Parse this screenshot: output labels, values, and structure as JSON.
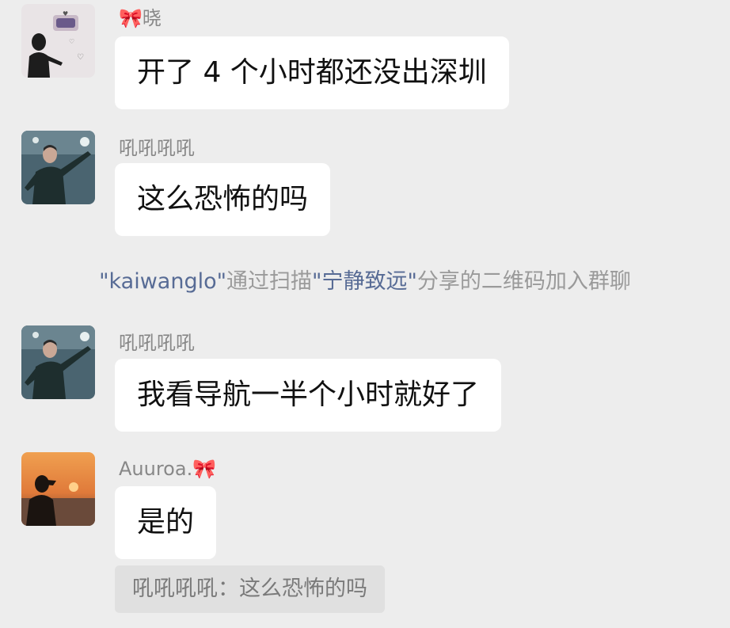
{
  "messages": [
    {
      "sender": "🎀晓",
      "text": "开了 4 个小时都还没出深圳",
      "avatar_icon": "girl-silhouette-cake-avatar"
    },
    {
      "sender": "吼吼吼吼",
      "text": "这么恐怖的吗",
      "avatar_icon": "man-pointing-avatar"
    },
    {
      "sender": "吼吼吼吼",
      "text": "我看导航一半个小时就好了",
      "avatar_icon": "man-pointing-avatar"
    },
    {
      "sender": "Auuroa.🎀",
      "text": "是的",
      "avatar_icon": "sunset-silhouette-avatar"
    }
  ],
  "system_notice": {
    "joiner": "\"kaiwanglo\"",
    "part1": "通过扫描",
    "sharer": "\"宁静致远\"",
    "part2": "分享的二维码加入群聊"
  },
  "quote": {
    "text": "吼吼吼吼：这么恐怖的吗"
  },
  "colors": {
    "background": "#ededed",
    "bubble": "#ffffff",
    "link_name": "#576b95",
    "quote_bg": "#e0e0e0"
  }
}
